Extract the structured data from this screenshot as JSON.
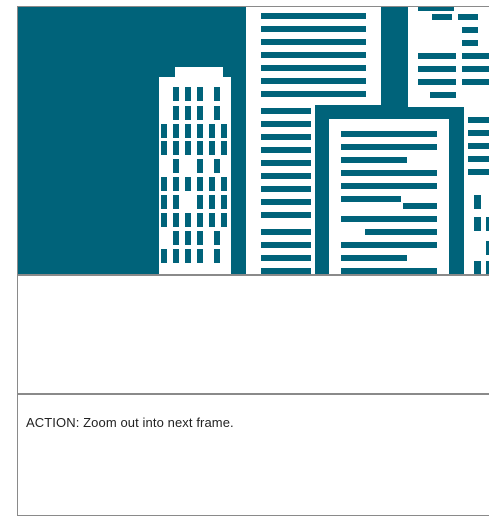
{
  "storyboard_frame": {
    "illustration": {
      "subject": "city-skyline",
      "colors": {
        "sky": "#00637a",
        "buildings": "#ffffff",
        "windows": "#00637a"
      }
    },
    "dialogue": "",
    "action": "ACTION: Zoom out into next frame."
  }
}
